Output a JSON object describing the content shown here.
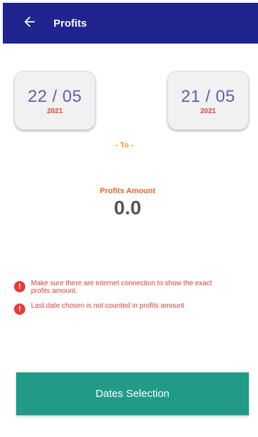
{
  "header": {
    "title": "Profits"
  },
  "dates": {
    "from": {
      "day_month": "22 / 05",
      "year": "2021"
    },
    "separator": "- To -",
    "to": {
      "day_month": "21 / 05",
      "year": "2021"
    }
  },
  "amount": {
    "label": "Profits Amount",
    "value": "0.0"
  },
  "notes": [
    {
      "icon": "info-icon",
      "text": "Make sure there are internet connection to show the exact profits amount."
    },
    {
      "icon": "info-icon",
      "text": "Last date chosen is not counted in profits amount"
    }
  ],
  "actions": {
    "dates_selection": "Dates Selection"
  },
  "colors": {
    "app_bar": "#1f248f",
    "accent_orange": "#e2672c",
    "date_text": "#6060a8",
    "year_text": "#e0422a",
    "warning": "#d93b3b",
    "button": "#219b87"
  }
}
